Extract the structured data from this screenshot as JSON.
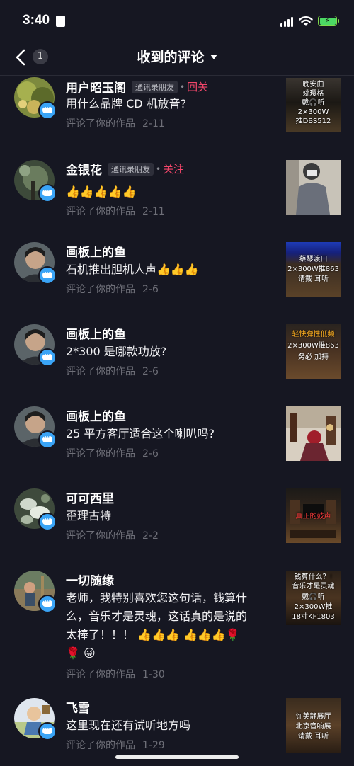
{
  "status": {
    "time": "3:40"
  },
  "nav": {
    "back_count": "1",
    "title": "收到的评论"
  },
  "comments": [
    {
      "name": "用户昭玉阁",
      "tag": "通讯录朋友",
      "follow": "回关",
      "text": "用什么品牌 CD 机放音?",
      "action": "评论了你的作品",
      "date": "2-11",
      "thumb_lines": [
        "晚安曲",
        "姚璎格",
        "戴🎧听",
        "2×300W",
        "推DBS512"
      ]
    },
    {
      "name": "金银花",
      "tag": "通讯录朋友",
      "follow": "关注",
      "text": "👍👍👍👍👍",
      "action": "评论了你的作品",
      "date": "2-11",
      "thumb_lines": []
    },
    {
      "name": "画板上的鱼",
      "tag": "",
      "follow": "",
      "text": "石机推出胆机人声👍👍👍",
      "action": "评论了你的作品",
      "date": "2-6",
      "thumb_lines": [
        "蔡琴渡口",
        "2×300W推863",
        "请戴  耳听"
      ]
    },
    {
      "name": "画板上的鱼",
      "tag": "",
      "follow": "",
      "text": "2*300 是哪款功放?",
      "action": "评论了你的作品",
      "date": "2-6",
      "thumb_lines": [
        "轻快弹性低频",
        "2×300W推863",
        "务必  加持"
      ]
    },
    {
      "name": "画板上的鱼",
      "tag": "",
      "follow": "",
      "text": "25 平方客厅适合这个喇叭吗?",
      "action": "评论了你的作品",
      "date": "2-6",
      "thumb_lines": []
    },
    {
      "name": "可可西里",
      "tag": "",
      "follow": "",
      "text": "歪理古特",
      "action": "评论了你的作品",
      "date": "2-2",
      "thumb_lines": [
        "真正的鼓声"
      ]
    },
    {
      "name": "一切随缘",
      "tag": "",
      "follow": "",
      "text": "老师，我特别喜欢您这句话，钱算什么，音乐才是灵魂，这话真的是说的太棒了！！！ 👍👍👍 👍👍👍🌹 🌹 😜",
      "action": "评论了你的作品",
      "date": "1-30",
      "thumb_lines": [
        "钱算什么？!",
        "音乐才是灵魂",
        "戴🎧听",
        "2×300W推",
        "18寸KF1803"
      ]
    },
    {
      "name": "飞雪",
      "tag": "",
      "follow": "",
      "text": "这里现在还有试听地方吗",
      "action": "评论了你的作品",
      "date": "1-29",
      "thumb_lines": [
        "许美静展厅",
        "北京音响展",
        "请戴  耳听"
      ]
    }
  ],
  "colors": {
    "background": "#161722",
    "accent": "#f2466a",
    "badge": "#3aa4f6",
    "muted": "#6e6f78"
  },
  "icons": [
    "back-arrow-icon",
    "dropdown-caret-icon",
    "chat-bubble-icon",
    "wifi-icon",
    "battery-icon",
    "signal-icon"
  ]
}
